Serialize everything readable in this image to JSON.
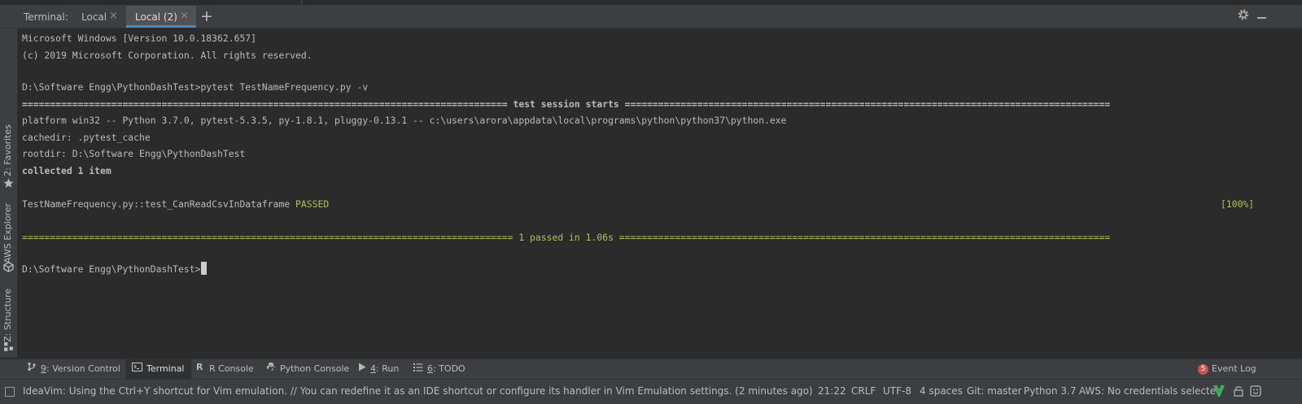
{
  "tabbar": {
    "label": "Terminal:",
    "tabs": [
      {
        "label": "Local",
        "active": false
      },
      {
        "label": "Local (2)",
        "active": true
      }
    ],
    "add_symbol": "+",
    "close_symbol": "×"
  },
  "sidebar": [
    {
      "label": "2: Favorites",
      "icon": "star-icon"
    },
    {
      "label": "AWS Explorer",
      "icon": "cube-icon"
    },
    {
      "label": "Z: Structure",
      "icon": "structure-icon"
    }
  ],
  "terminal": {
    "lines": [
      "Microsoft Windows [Version 10.0.18362.657]",
      "(c) 2019 Microsoft Corporation. All rights reserved.",
      "D:\\Software Engg\\PythonDashTest>pytest TestNameFrequency.py -v",
      "platform win32 -- Python 3.7.0, pytest-5.3.5, py-1.8.1, pluggy-0.13.1 -- c:\\users\\arora\\appdata\\local\\programs\\python\\python37\\python.exe",
      "cachedir: .pytest_cache",
      "rootdir: D:\\Software Engg\\PythonDashTest",
      "collected 1 item"
    ],
    "session_header": " test session starts ",
    "test_name": "TestNameFrequency.py::test_CanReadCsvInDataframe ",
    "test_status": "PASSED",
    "test_percent": "[100%]",
    "summary": " 1 passed in 1.06s ",
    "prompt": "D:\\Software Engg\\PythonDashTest>"
  },
  "bottom_tabs": [
    {
      "prefix": "",
      "mnemonic": "9",
      "label": ": Version Control",
      "icon": "version-control-icon"
    },
    {
      "prefix": "",
      "mnemonic": "",
      "label": "Terminal",
      "icon": "terminal-icon"
    },
    {
      "prefix": "",
      "mnemonic": "",
      "label": "R Console",
      "icon": "r-console-icon"
    },
    {
      "prefix": "",
      "mnemonic": "",
      "label": "Python Console",
      "icon": "python-console-icon"
    },
    {
      "prefix": "",
      "mnemonic": "4",
      "label": ": Run",
      "icon": "run-icon"
    },
    {
      "prefix": "",
      "mnemonic": "6",
      "label": ": TODO",
      "icon": "todo-icon"
    }
  ],
  "event_log": {
    "count": "5",
    "label": "Event Log"
  },
  "status": {
    "message": "IdeaVim: Using the Ctrl+Y shortcut for Vim emulation. // You can redefine it as an IDE shortcut or configure its handler in Vim Emulation settings. (2 minutes ago)",
    "position": "21:22",
    "line_ending": "CRLF",
    "encoding": "UTF-8",
    "indent": "4 spaces",
    "git": "Git: master",
    "python": "Python 3.7",
    "aws": "AWS: No credentials selected"
  },
  "colors": {
    "background": "#2b2b2b",
    "panel": "#3c3f41",
    "text": "#bbbbbb",
    "passed": "#b3c15a",
    "accent": "#4a88c7",
    "badge": "#c75450"
  }
}
